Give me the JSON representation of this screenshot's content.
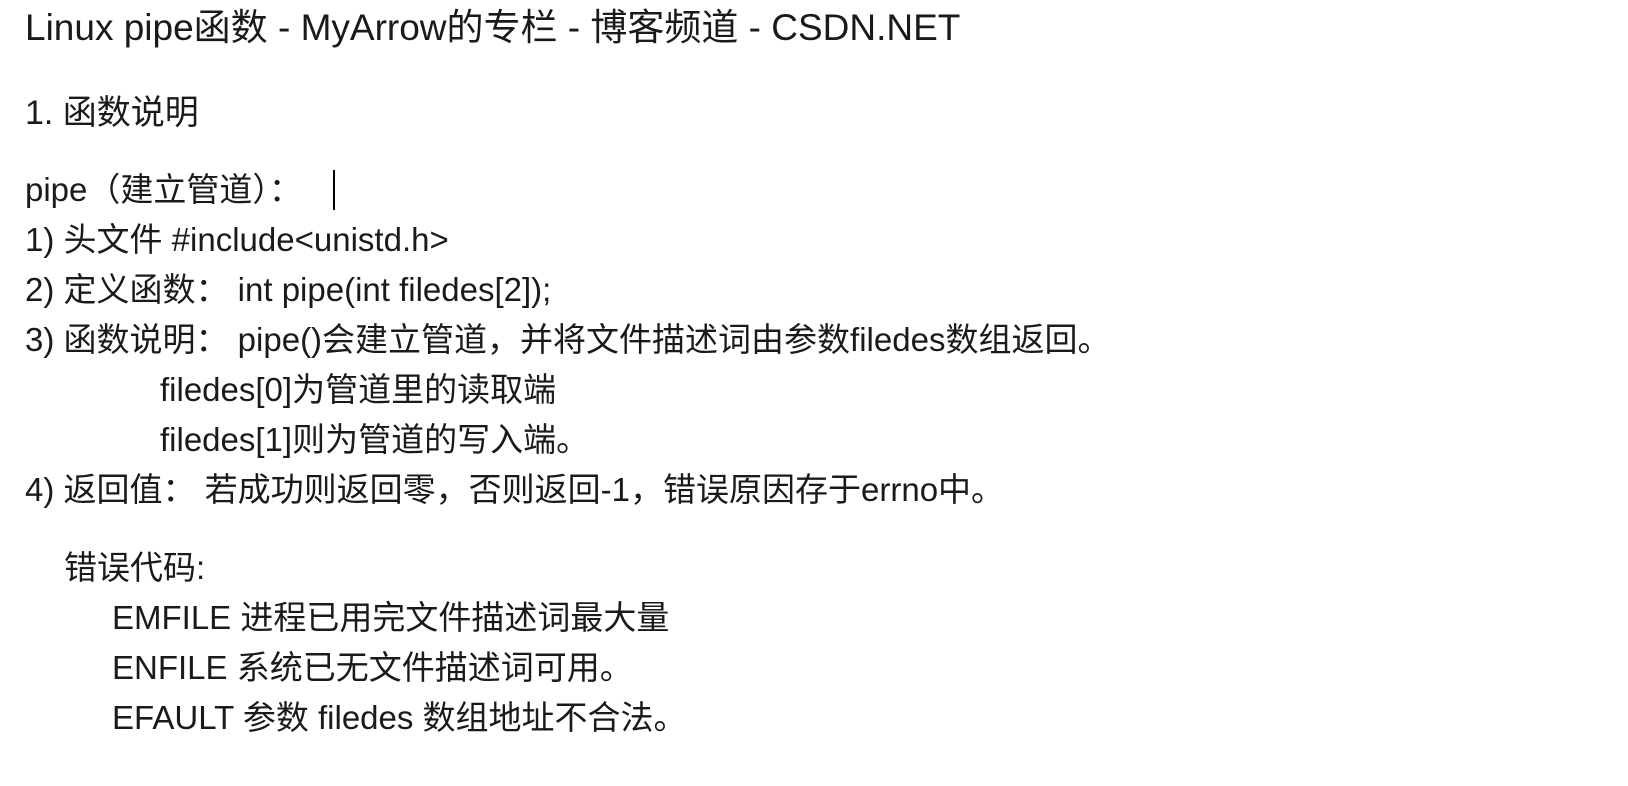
{
  "document": {
    "title": "Linux pipe函数 - MyArrow的专栏 - 博客频道 - CSDN.NET",
    "section_heading": "1. 函数说明",
    "lines": {
      "pipe": "pipe（建立管道）：",
      "header_file": "1) 头文件 #include<unistd.h>",
      "definition": "2) 定义函数：  int pipe(int filedes[2]);",
      "description": "3) 函数说明：  pipe()会建立管道，并将文件描述词由参数filedes数组返回。",
      "description_read": "filedes[0]为管道里的读取端",
      "description_write": "filedes[1]则为管道的写入端。",
      "return_value": "4) 返回值：   若成功则返回零，否则返回-1，错误原因存于errno中。",
      "error_codes_label": "错误代码:",
      "err_emfile": "EMFILE 进程已用完文件描述词最大量",
      "err_enfile": "ENFILE 系统已无文件描述词可用。",
      "err_efault": "EFAULT 参数 filedes 数组地址不合法。"
    }
  }
}
